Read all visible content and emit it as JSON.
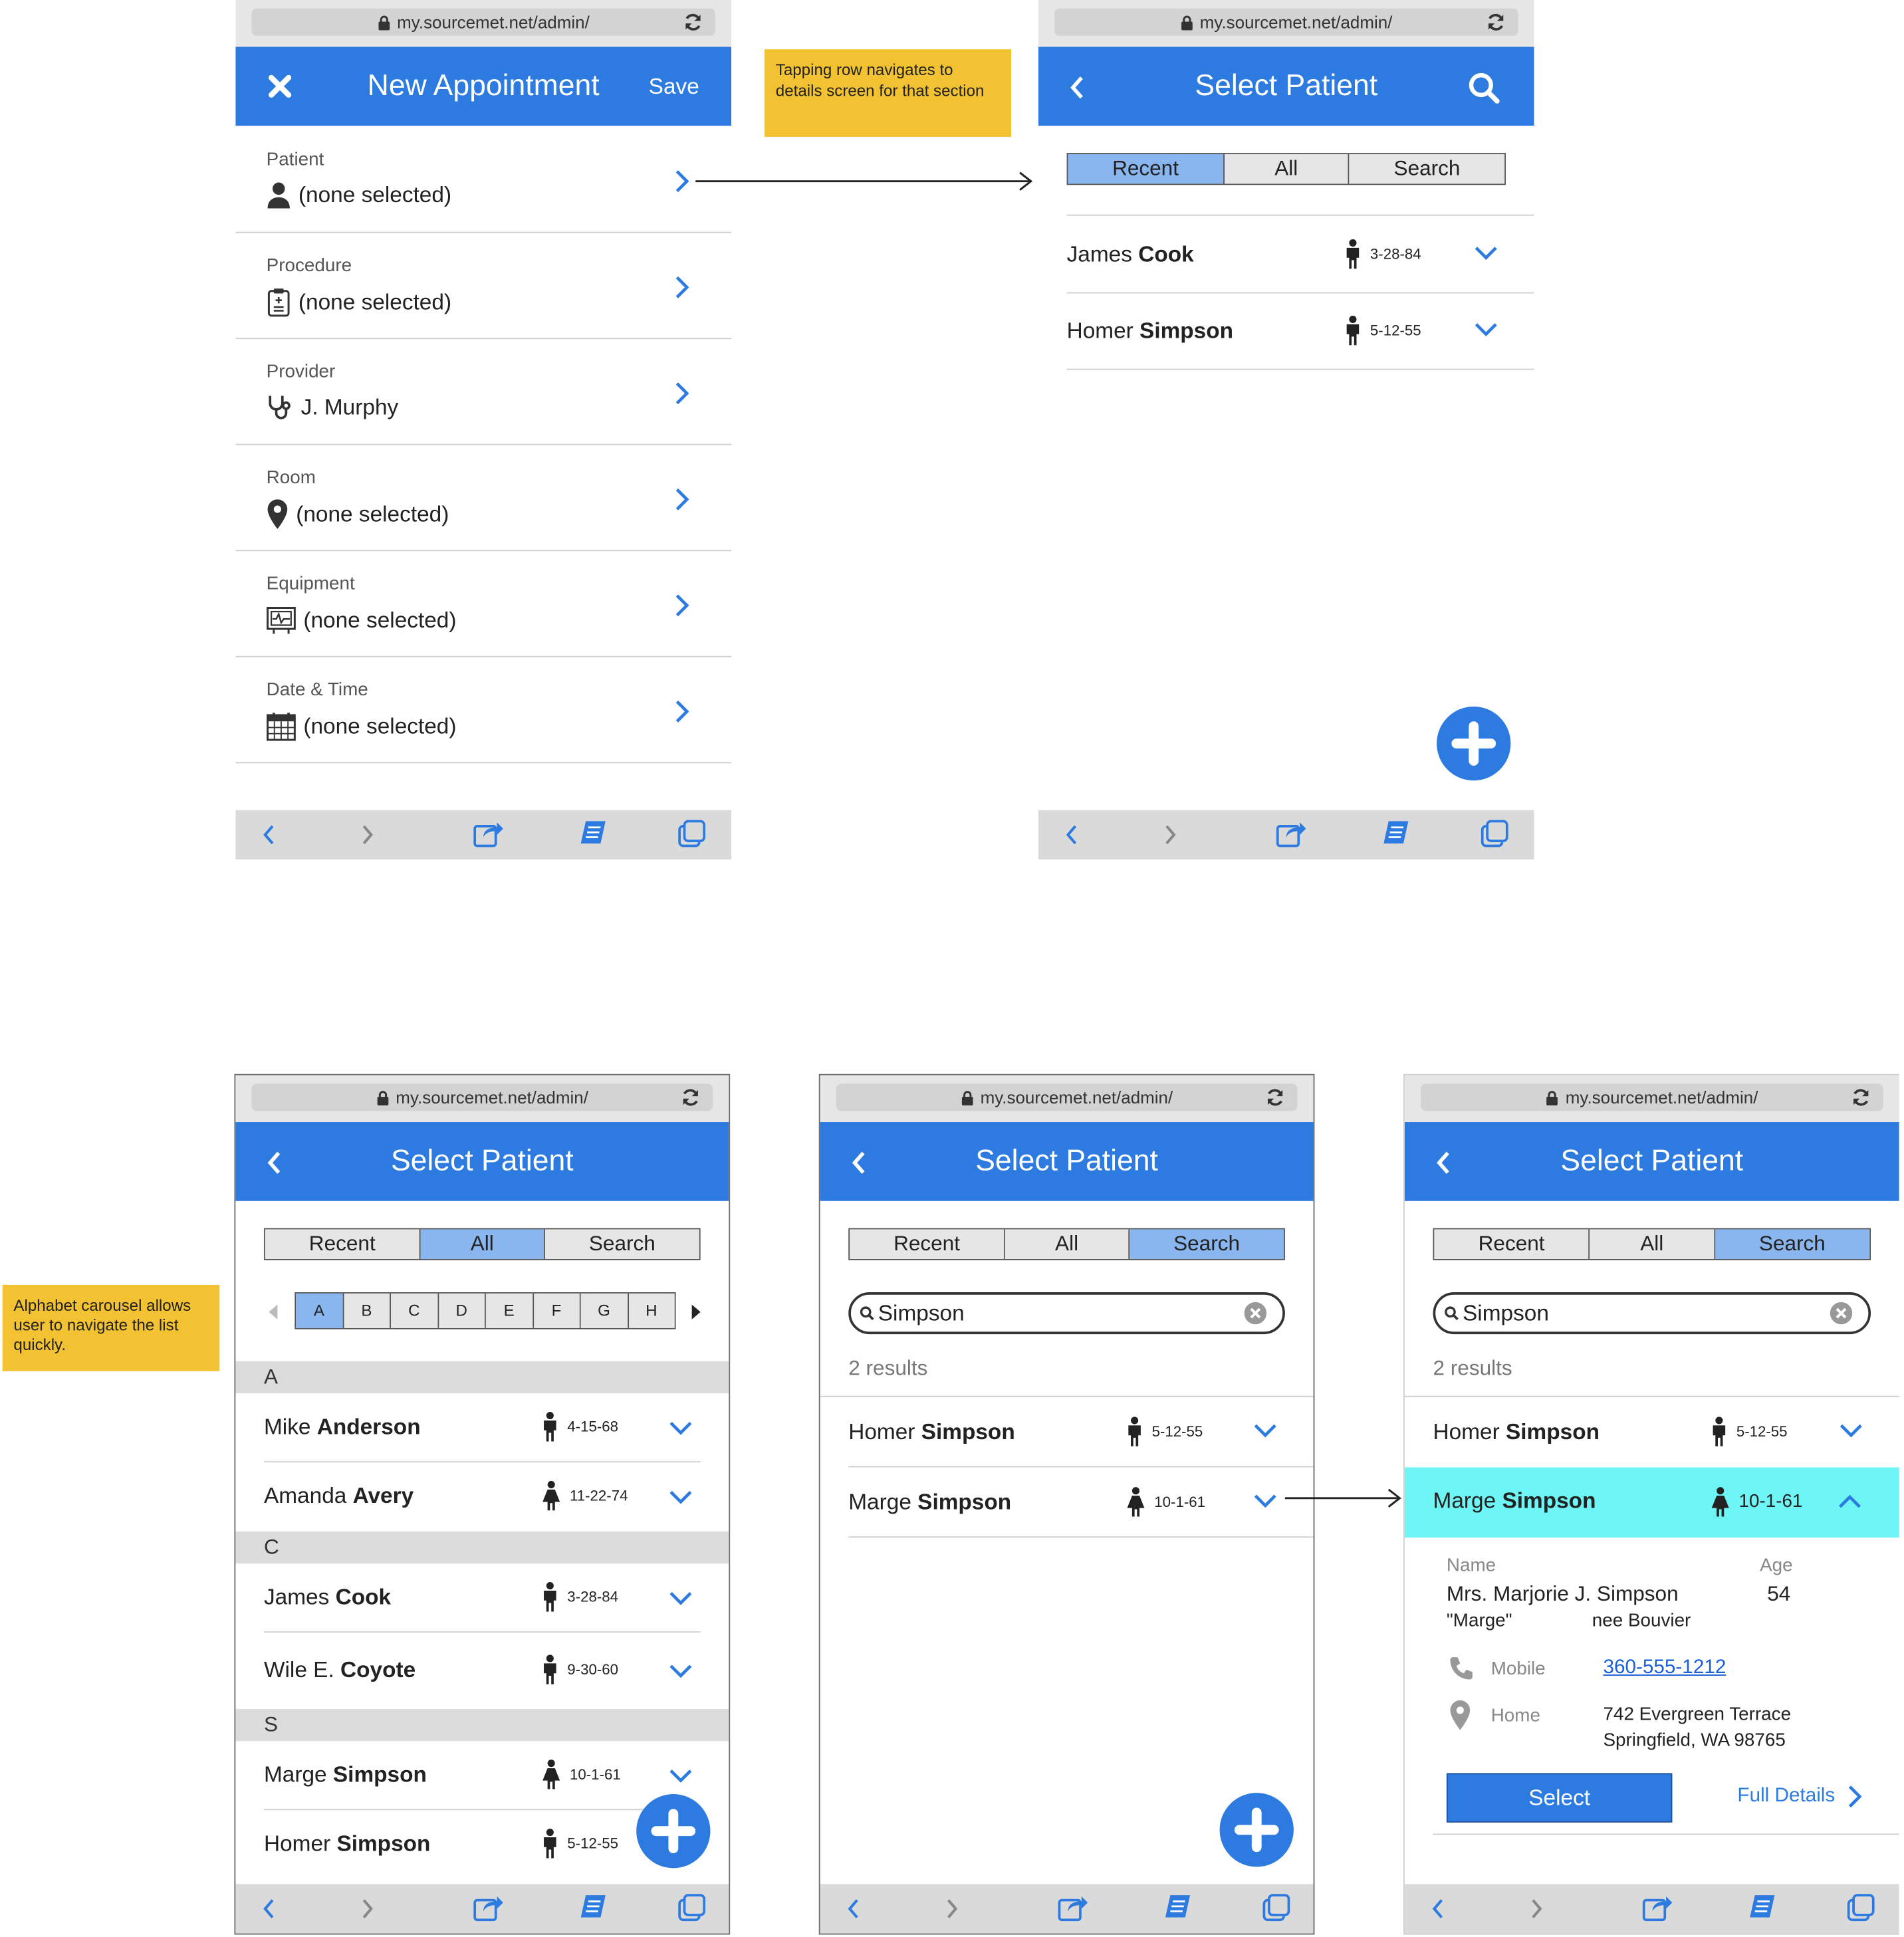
{
  "browser": {
    "url": "my.sourcemet.net/admin/"
  },
  "screen1": {
    "title": "New Appointment",
    "save_label": "Save",
    "rows": [
      {
        "label": "Patient",
        "value": "(none selected)",
        "icon": "person-icon"
      },
      {
        "label": "Procedure",
        "value": "(none selected)",
        "icon": "clipboard-icon"
      },
      {
        "label": "Provider",
        "value": "J. Murphy",
        "icon": "stethoscope-icon"
      },
      {
        "label": "Room",
        "value": "(none selected)",
        "icon": "map-pin-icon"
      },
      {
        "label": "Equipment",
        "value": "(none selected)",
        "icon": "monitor-icon"
      },
      {
        "label": "Date & Time",
        "value": "(none selected)",
        "icon": "calendar-icon"
      }
    ]
  },
  "notes": {
    "tap_row": "Tapping row navigates to details screen for that section",
    "alphabet": "Alphabet carousel allows user to navigate the list quickly."
  },
  "select_patient": {
    "title": "Select Patient",
    "tabs": [
      "Recent",
      "All",
      "Search"
    ]
  },
  "screen2": {
    "patients": [
      {
        "first": "James",
        "last": "Cook",
        "dob": "3-28-84",
        "gender": "male"
      },
      {
        "first": "Homer",
        "last": "Simpson",
        "dob": "5-12-55",
        "gender": "male"
      }
    ]
  },
  "screen3": {
    "letters": [
      "A",
      "B",
      "C",
      "D",
      "E",
      "F",
      "G",
      "H"
    ],
    "sections": [
      {
        "letter": "A",
        "patients": [
          {
            "first": "Mike",
            "last": "Anderson",
            "dob": "4-15-68",
            "gender": "male"
          },
          {
            "first": "Amanda",
            "last": "Avery",
            "dob": "11-22-74",
            "gender": "female"
          }
        ]
      },
      {
        "letter": "C",
        "patients": [
          {
            "first": "James",
            "last": "Cook",
            "dob": "3-28-84",
            "gender": "male"
          },
          {
            "first": "Wile E.",
            "last": "Coyote",
            "dob": "9-30-60",
            "gender": "male"
          }
        ]
      },
      {
        "letter": "S",
        "patients": [
          {
            "first": "Marge",
            "last": "Simpson",
            "dob": "10-1-61",
            "gender": "female"
          },
          {
            "first": "Homer",
            "last": "Simpson",
            "dob": "5-12-55",
            "gender": "male"
          }
        ]
      }
    ]
  },
  "search": {
    "query": "Simpson",
    "results_label": "2 results",
    "patients": [
      {
        "first": "Homer",
        "last": "Simpson",
        "dob": "5-12-55",
        "gender": "male"
      },
      {
        "first": "Marge",
        "last": "Simpson",
        "dob": "10-1-61",
        "gender": "female"
      }
    ]
  },
  "detail": {
    "name_label": "Name",
    "age_label": "Age",
    "full_name": "Mrs. Marjorie J. Simpson",
    "nickname": "\"Marge\"",
    "maiden": "nee Bouvier",
    "age": "54",
    "mobile_label": "Mobile",
    "mobile": "360-555-1212",
    "home_label": "Home",
    "address_line1": "742 Evergreen Terrace",
    "address_line2": "Springfield, WA 98765",
    "select_label": "Select",
    "full_details_label": "Full Details",
    "highlight_color": "#6ef6f6"
  },
  "colors": {
    "accent": "#2d7be0",
    "tab_active": "#8ab6f0",
    "note": "#f2c232"
  }
}
